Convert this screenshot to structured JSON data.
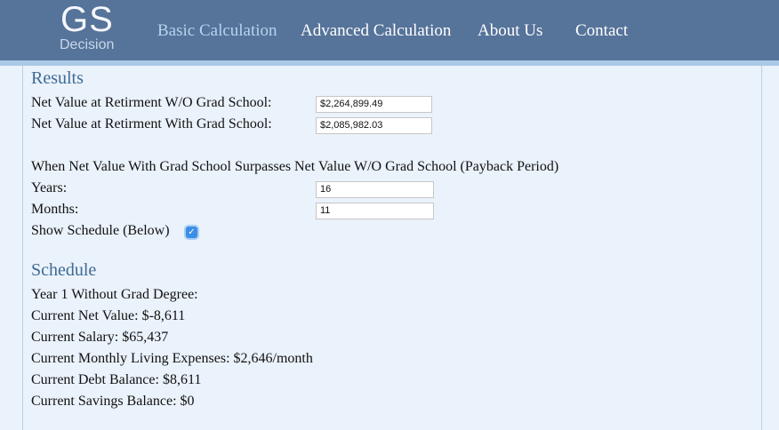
{
  "header": {
    "logo": {
      "main": "GS",
      "sub": "Decision"
    },
    "nav": [
      {
        "label": "Basic Calculation",
        "active": true
      },
      {
        "label": "Advanced Calculation"
      },
      {
        "label": "About Us"
      },
      {
        "label": "Contact"
      }
    ]
  },
  "results": {
    "title": "Results",
    "net_wo_label": "Net Value at Retirment W/O Grad School:",
    "net_wo_value": "$2,264,899.49",
    "net_with_label": "Net Value at Retirment With Grad School:",
    "net_with_value": "$2,085,982.03",
    "payback_heading": "When Net Value With Grad School Surpasses Net Value W/O Grad School (Payback Period)",
    "years_label": "Years:",
    "years_value": "16",
    "months_label": "Months:",
    "months_value": "11",
    "show_schedule_label": "Show Schedule (Below)",
    "show_schedule_checked": true
  },
  "schedule": {
    "title": "Schedule",
    "lines": [
      "Year 1 Without Grad Degree:",
      "Current Net Value: $-8,611",
      "Current Salary: $65,437",
      "Current Monthly Living Expenses: $2,646/month",
      "Current Debt Balance: $8,611",
      "Current Savings Balance: $0"
    ]
  },
  "colors": {
    "header_bg": "#56739a",
    "accent_heading": "#3e6a93",
    "page_bg": "#eaf2fb"
  }
}
